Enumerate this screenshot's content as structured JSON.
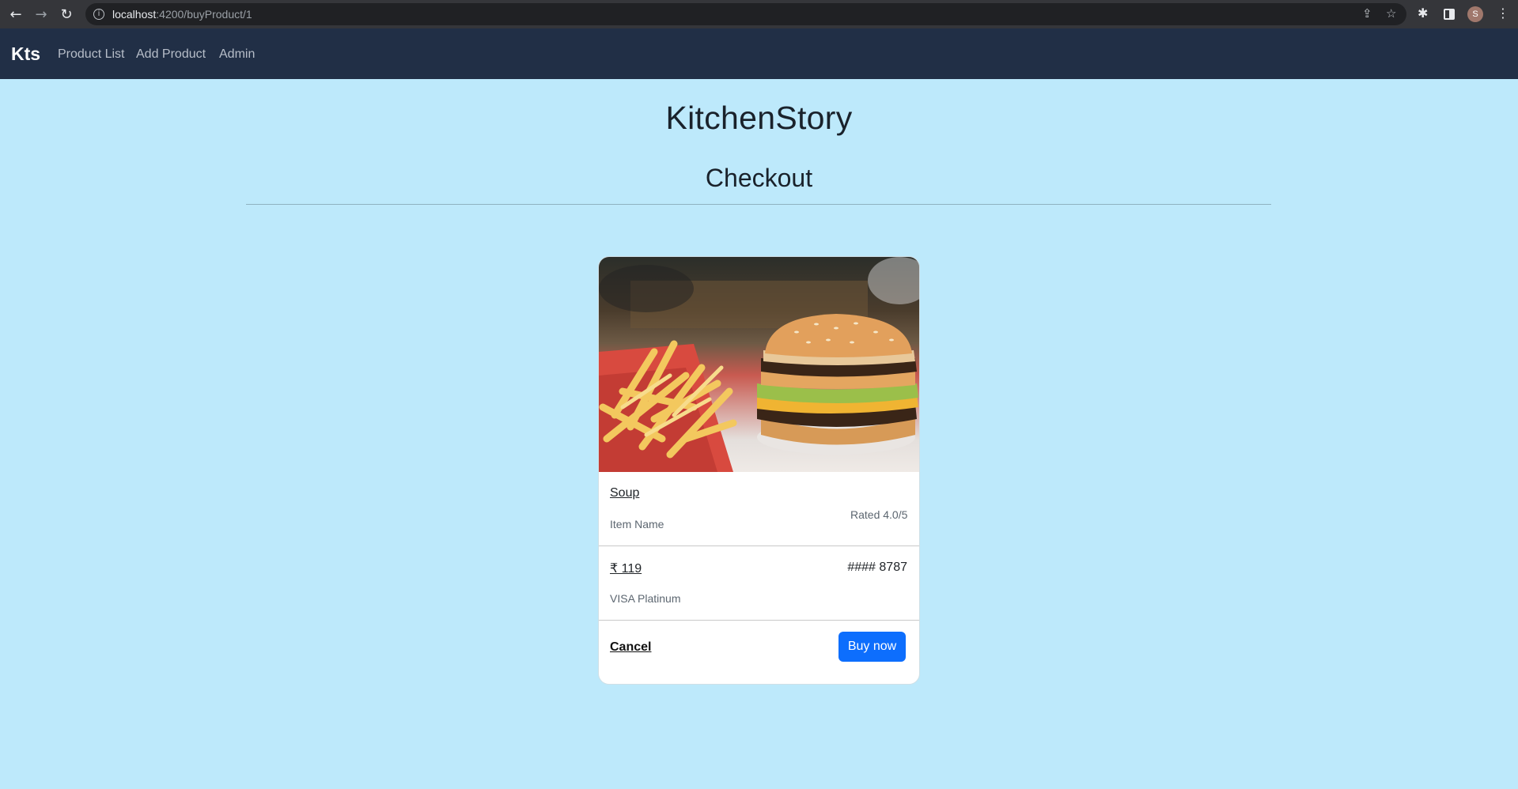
{
  "browser": {
    "url_host": "localhost",
    "url_path": ":4200/buyProduct/1",
    "avatar_initial": "S"
  },
  "navbar": {
    "brand": "Kts",
    "links": [
      "Product List",
      "Add Product",
      "Admin"
    ]
  },
  "page": {
    "title": "KitchenStory",
    "subtitle": "Checkout"
  },
  "card": {
    "image_icon": "burger-and-fries-photo",
    "item_name": "Soup",
    "item_name_label": "Item Name",
    "rating": "Rated 4.0/5",
    "price": "₹ 119",
    "card_number": "#### 8787",
    "card_type": "VISA Platinum",
    "cancel_label": "Cancel",
    "buy_label": "Buy now"
  },
  "colors": {
    "background": "#bde9fb",
    "navbar": "#212f46",
    "primary_button": "#0d6efd"
  }
}
